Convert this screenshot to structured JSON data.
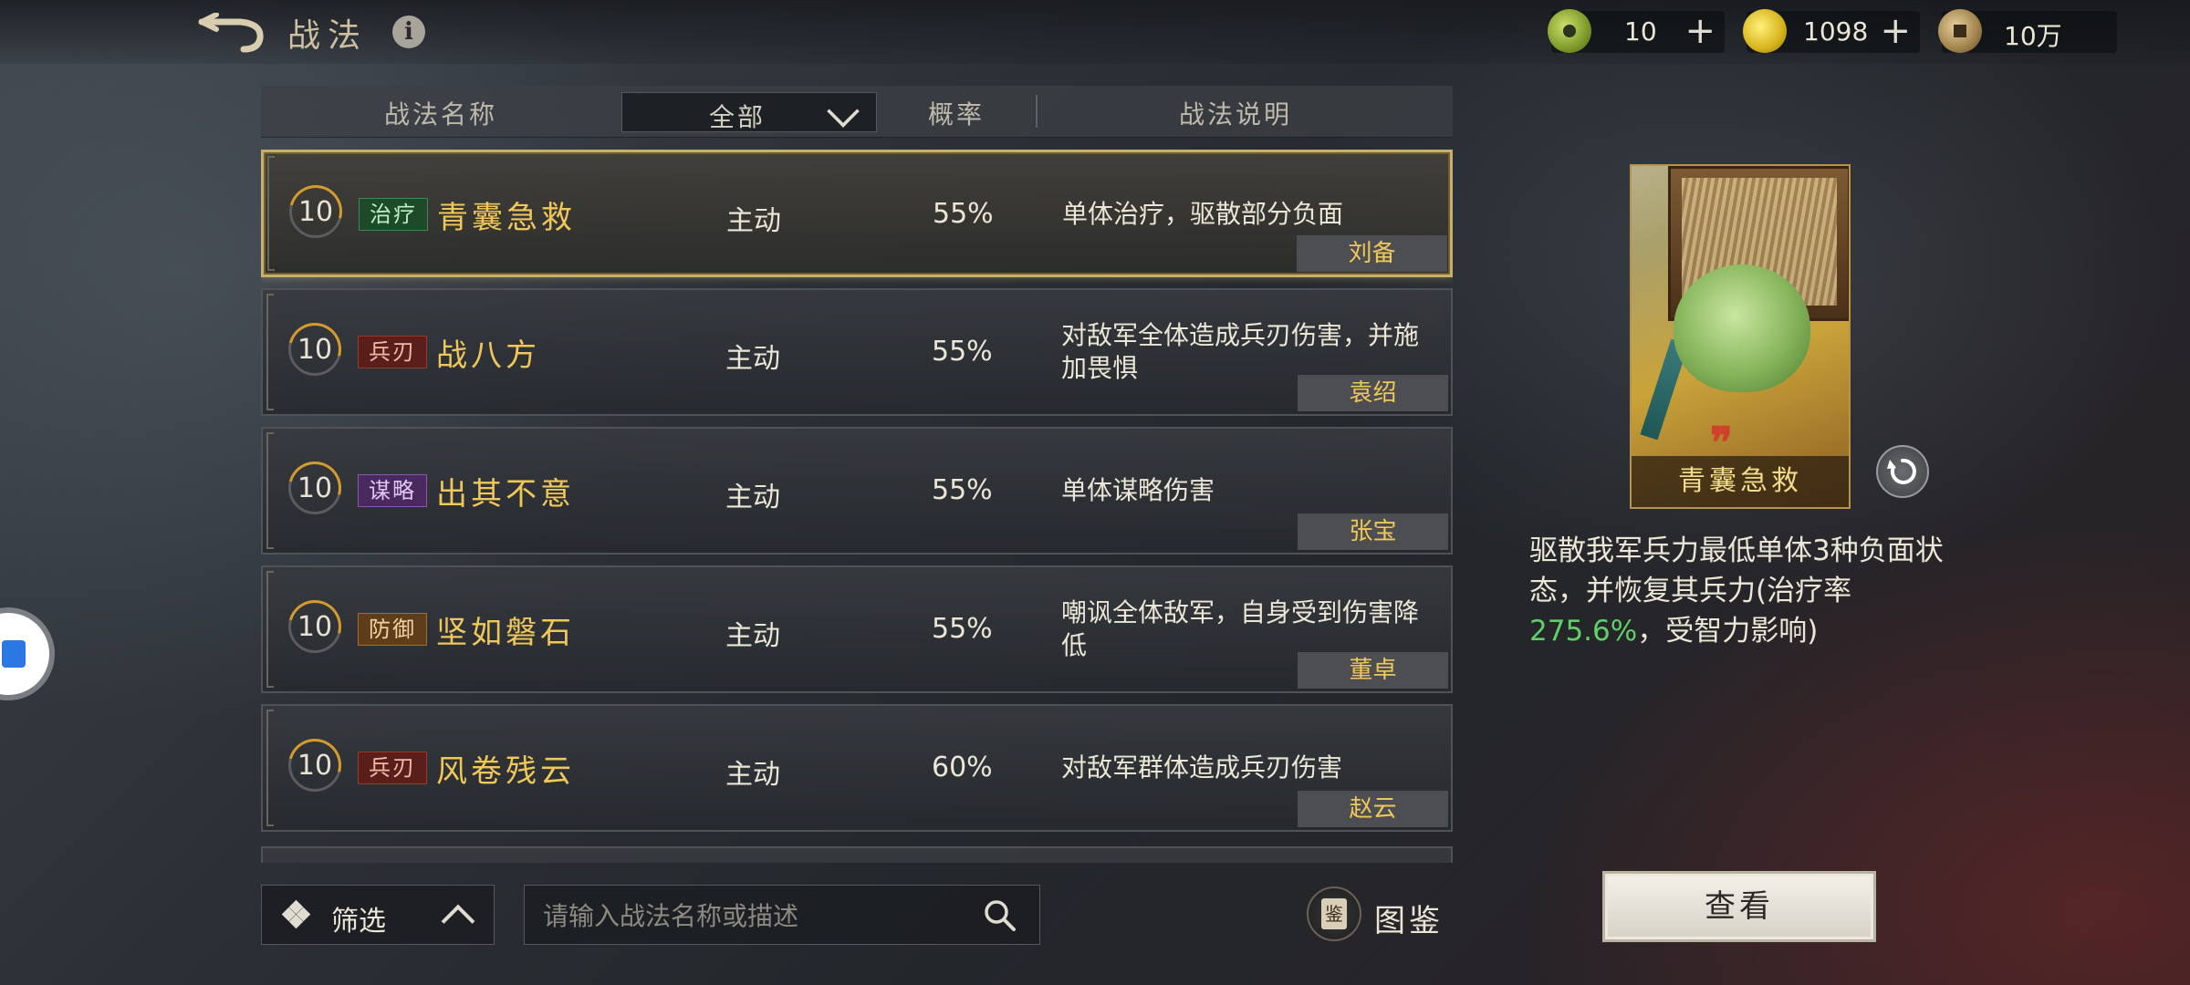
{
  "header": {
    "title": "战法",
    "currencies": [
      {
        "icon": "jade-coin-icon",
        "value": "10",
        "has_plus": true
      },
      {
        "icon": "gold-coin-icon",
        "value": "1098",
        "has_plus": true
      },
      {
        "icon": "copper-coin-icon",
        "value": "10万",
        "has_plus": false
      }
    ]
  },
  "table": {
    "col_name": "战法名称",
    "filter_value": "全部",
    "col_rate": "概率",
    "col_desc": "战法说明",
    "rows": [
      {
        "level": "10",
        "tag": "治疗",
        "name": "青囊急救",
        "type": "主动",
        "rate": "55%",
        "desc": "单体治疗，驱散部分负面",
        "hero": "刘备"
      },
      {
        "level": "10",
        "tag": "兵刃",
        "name": "战八方",
        "type": "主动",
        "rate": "55%",
        "desc": "对敌军全体造成兵刃伤害，并施加畏惧",
        "hero": "袁绍"
      },
      {
        "level": "10",
        "tag": "谋略",
        "name": "出其不意",
        "type": "主动",
        "rate": "55%",
        "desc": "单体谋略伤害",
        "hero": "张宝"
      },
      {
        "level": "10",
        "tag": "防御",
        "name": "坚如磐石",
        "type": "主动",
        "rate": "55%",
        "desc": "嘲讽全体敌军，自身受到伤害降低",
        "hero": "董卓"
      },
      {
        "level": "10",
        "tag": "兵刃",
        "name": "风卷残云",
        "type": "主动",
        "rate": "60%",
        "desc": "对敌军群体造成兵刃伤害",
        "hero": "赵云"
      }
    ]
  },
  "bottom": {
    "filter_label": "筛选",
    "search_placeholder": "请输入战法名称或描述",
    "atlas_icon_char": "鉴",
    "atlas_label": "图鉴"
  },
  "detail": {
    "card_name": "青囊急救",
    "card_quote": "❞",
    "text_before": "驱散我军兵力最低单体3种负面状态，并恢复其兵力(治疗率",
    "text_highlight": "275.6%",
    "text_after": "，受智力影响)",
    "view_button": "查看"
  },
  "colors": {
    "accent_gold": "#f0c85a",
    "highlight_green": "#5fcf68",
    "selected_border": "#c9b06a"
  }
}
